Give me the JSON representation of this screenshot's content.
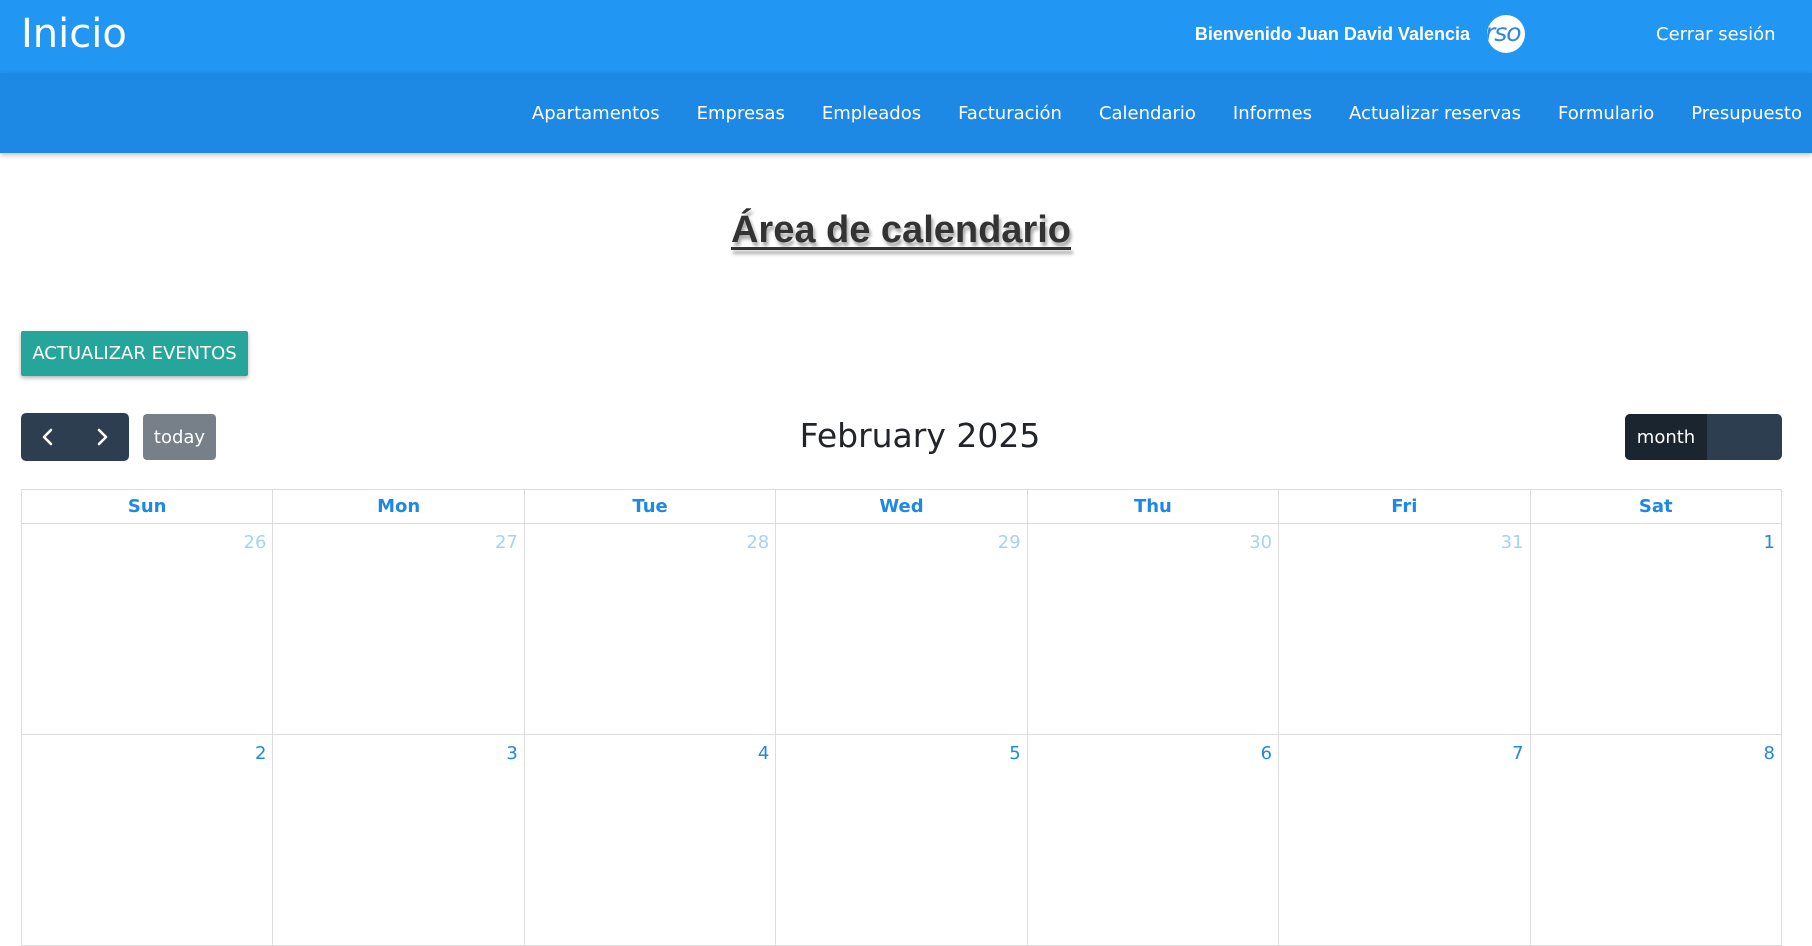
{
  "header": {
    "brand": "Inicio",
    "welcome": "Bienvenido Juan David Valencia",
    "avatar_text": "rso",
    "logout": "Cerrar sesión"
  },
  "nav": {
    "items": [
      "Apartamentos",
      "Empresas",
      "Empleados",
      "Facturación",
      "Calendario",
      "Informes",
      "Actualizar reservas",
      "Formulario",
      "Presupuesto"
    ]
  },
  "page": {
    "title": "Área de calendario",
    "update_button": "ACTUALIZAR EVENTOS"
  },
  "icons": {
    "prev": "chevron-left-icon",
    "next": "chevron-right-icon"
  },
  "calendar": {
    "today_label": "today",
    "title": "February 2025",
    "view_month": "month",
    "days": [
      "Sun",
      "Mon",
      "Tue",
      "Wed",
      "Thu",
      "Fri",
      "Sat"
    ],
    "weeks": [
      [
        "26",
        "27",
        "28",
        "29",
        "30",
        "31",
        "1"
      ],
      [
        "2",
        "3",
        "4",
        "5",
        "6",
        "7",
        "8"
      ]
    ]
  },
  "colors": {
    "topbar": "#2196f3",
    "navbar": "#1e88e5",
    "update_button": "#26a69a",
    "toolbar_dark": "#2c3e50",
    "today_button": "#778089",
    "day_header": "#1e88e5",
    "other_month_day": "#a6d3f3"
  }
}
